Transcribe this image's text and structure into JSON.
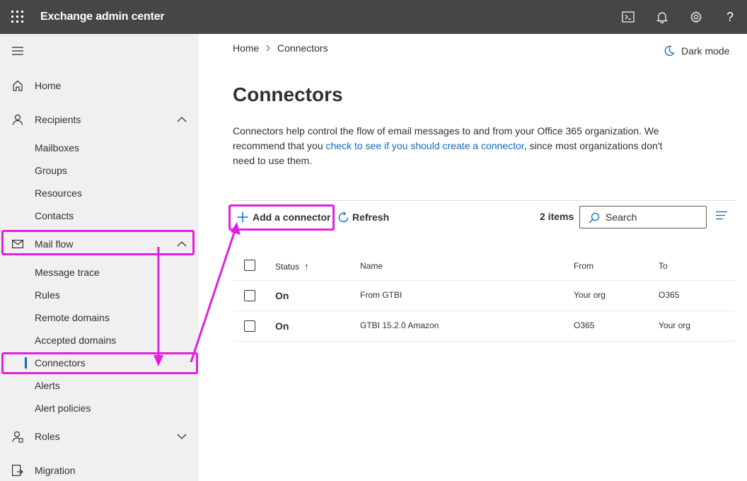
{
  "header": {
    "app_title": "Exchange admin center",
    "icons": [
      "waffle-icon",
      "terminal-icon",
      "bell-icon",
      "gear-icon",
      "help-icon"
    ],
    "help_glyph": "?"
  },
  "sidebar": {
    "items": [
      {
        "label": "Home",
        "icon": "home-icon"
      },
      {
        "label": "Recipients",
        "icon": "person-icon",
        "expanded": true
      },
      {
        "label": "Mailboxes"
      },
      {
        "label": "Groups"
      },
      {
        "label": "Resources"
      },
      {
        "label": "Contacts"
      },
      {
        "label": "Mail flow",
        "icon": "mail-icon",
        "expanded": true
      },
      {
        "label": "Message trace"
      },
      {
        "label": "Rules"
      },
      {
        "label": "Remote domains"
      },
      {
        "label": "Accepted domains"
      },
      {
        "label": "Connectors",
        "selected": true
      },
      {
        "label": "Alerts"
      },
      {
        "label": "Alert policies"
      },
      {
        "label": "Roles",
        "icon": "roles-icon",
        "expanded": false
      },
      {
        "label": "Migration",
        "icon": "migration-icon"
      }
    ]
  },
  "breadcrumb": {
    "home": "Home",
    "current": "Connectors"
  },
  "dark_mode_label": "Dark mode",
  "page": {
    "title": "Connectors",
    "desc_before": "Connectors help control the flow of email messages to and from your Office 365 organization. We recommend that you ",
    "desc_link": "check to see if you should create a connector",
    "desc_after": ", since most organizations don't need to use them."
  },
  "toolbar": {
    "add_label": "Add a connector",
    "refresh_label": "Refresh",
    "item_count": "2 items",
    "search_placeholder": "Search"
  },
  "table": {
    "columns": [
      "Status",
      "Name",
      "From",
      "To"
    ],
    "sort_glyph": "↑",
    "rows": [
      {
        "status": "On",
        "name": "From GTBI",
        "from": "Your org",
        "to": "O365"
      },
      {
        "status": "On",
        "name": "GTBI 15.2.0 Amazon",
        "from": "O365",
        "to": "Your org"
      }
    ]
  },
  "colors": {
    "topbar": "#484644",
    "sidebar": "#f0f0f0",
    "accent": "#0f6cbd",
    "annotation": "#e020e0"
  }
}
